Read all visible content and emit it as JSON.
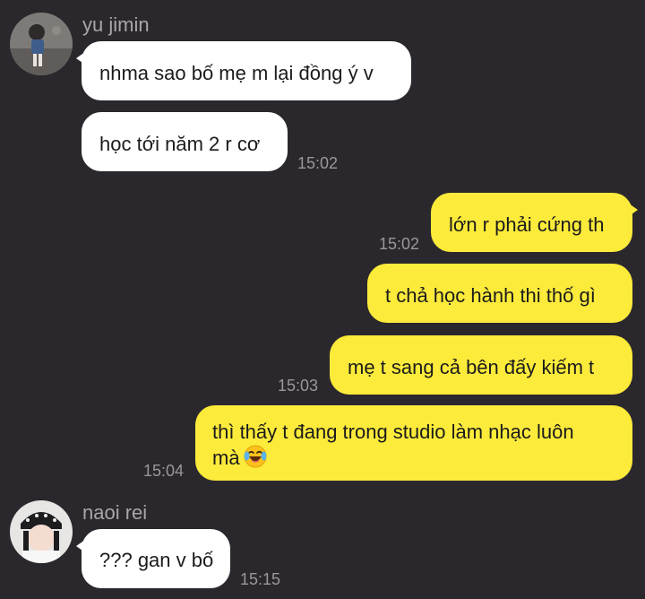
{
  "colors": {
    "background": "#2b282d",
    "incoming_bubble": "#ffffff",
    "outgoing_bubble": "#fdeb3b",
    "name_text": "#a9a6ab",
    "time_text": "#9a979c"
  },
  "senders": {
    "first": {
      "name": "yu jimin",
      "avatar": "avatar-photo-girl-street"
    },
    "second": {
      "name": "naoi rei",
      "avatar": "avatar-photo-girl-beanie"
    }
  },
  "messages": [
    {
      "from": "yu jimin",
      "text": "nhma sao bố mẹ m lại đồng ý v",
      "time": ""
    },
    {
      "from": "yu jimin",
      "text": "học tới năm 2 r cơ",
      "time": "15:02"
    },
    {
      "from": "me",
      "text": "lớn r phải cứng th",
      "time": "15:02"
    },
    {
      "from": "me",
      "text": "t chả học hành thi thố gì",
      "time": ""
    },
    {
      "from": "me",
      "text": "mẹ t sang cả bên đấy kiếm t",
      "time": "15:03"
    },
    {
      "from": "me",
      "text_line1": "thì thấy t đang trong studio làm nhạc luôn",
      "text_line2": "mà",
      "emoji": "laughing-tears-emoji",
      "time": "15:04"
    },
    {
      "from": "naoi rei",
      "text": "??? gan v bố",
      "time": "15:15"
    }
  ]
}
